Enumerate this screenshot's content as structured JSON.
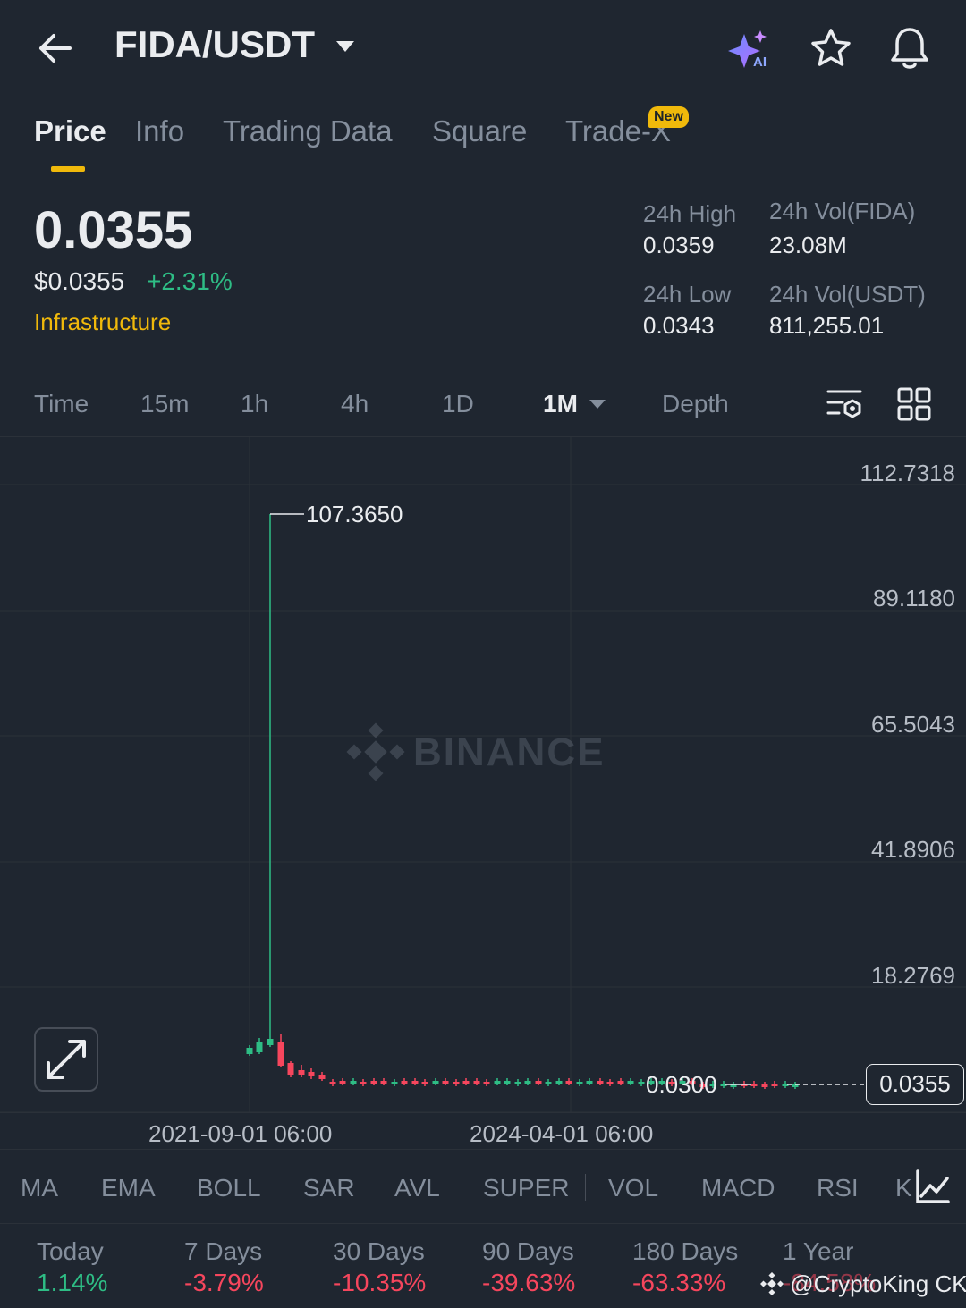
{
  "header": {
    "pair": "FIDA/USDT",
    "ai_badge": "AI"
  },
  "tabs": [
    {
      "label": "Price"
    },
    {
      "label": "Info"
    },
    {
      "label": "Trading Data"
    },
    {
      "label": "Square"
    },
    {
      "label": "Trade-X"
    }
  ],
  "new_badge": "New",
  "price": {
    "last": "0.0355",
    "usd": "$0.0355",
    "change_pct": "+2.31%",
    "category": "Infrastructure"
  },
  "stats": {
    "high_label": "24h High",
    "high": "0.0359",
    "low_label": "24h Low",
    "low": "0.0343",
    "vol_base_label": "24h Vol(FIDA)",
    "vol_base": "23.08M",
    "vol_quote_label": "24h Vol(USDT)",
    "vol_quote": "811,255.01"
  },
  "intervals": [
    "Time",
    "15m",
    "1h",
    "4h",
    "1D",
    "1M",
    "Depth"
  ],
  "active_interval": "1M",
  "chart": {
    "y_labels": [
      "112.7318",
      "89.1180",
      "65.5043",
      "41.8906",
      "18.2769"
    ],
    "x_labels": [
      "2021-09-01 06:00",
      "2024-04-01 06:00"
    ],
    "peak_label": "107.3650",
    "low_label": "0.0300",
    "current_price": "0.0355",
    "watermark": "BINANCE",
    "colors": {
      "up": "#2ebd85",
      "down": "#f6465d"
    }
  },
  "indicators": [
    "MA",
    "EMA",
    "BOLL",
    "SAR",
    "AVL",
    "SUPER",
    "VOL",
    "MACD",
    "RSI",
    "K"
  ],
  "performance": [
    {
      "label": "Today",
      "value": "1.14%",
      "dir": "up"
    },
    {
      "label": "7 Days",
      "value": "-3.79%",
      "dir": "down"
    },
    {
      "label": "30 Days",
      "value": "-10.35%",
      "dir": "down"
    },
    {
      "label": "90 Days",
      "value": "-39.63%",
      "dir": "down"
    },
    {
      "label": "180 Days",
      "value": "-63.33%",
      "dir": "down"
    },
    {
      "label": "1 Year",
      "value": "-84.58%",
      "dir": "down"
    }
  ],
  "credit": "@CryptoKing CK"
}
